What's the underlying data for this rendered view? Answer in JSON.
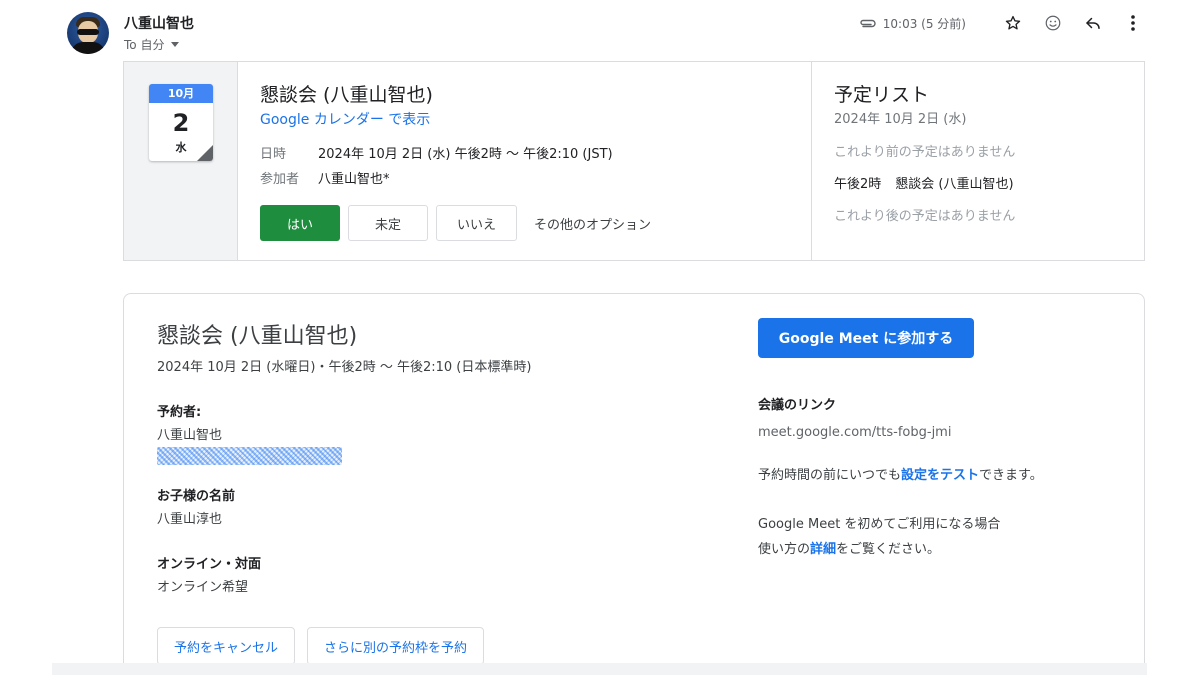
{
  "header": {
    "sender": "八重山智也",
    "to_label": "To 自分",
    "time": "10:03 (5 分前)"
  },
  "invite": {
    "calendar_icon": {
      "month": "10月",
      "day": "2",
      "weekday": "水"
    },
    "title": "懇談会 (八重山智也)",
    "view_link": "Google カレンダー で表示",
    "when_label": "日時",
    "when_value": "2024年 10月 2日 (水) 午後2時 ～ 午後2:10 (JST)",
    "guests_label": "参加者",
    "guests_value": "八重山智也*",
    "rsvp": {
      "yes": "はい",
      "maybe": "未定",
      "no": "いいえ",
      "other": "その他のオプション"
    },
    "agenda": {
      "title": "予定リスト",
      "date": "2024年 10月 2日 (水)",
      "before": "これより前の予定はありません",
      "event_time": "午後2時",
      "event_title": "懇談会 (八重山智也)",
      "after": "これより後の予定はありません"
    }
  },
  "booking": {
    "title": "懇談会 (八重山智也)",
    "subtitle": "2024年 10月 2日 (水曜日)・午後2時 ～ 午後2:10 (日本標準時)",
    "organizer_label": "予約者:",
    "organizer_name": "八重山智也",
    "child_label": "お子様の名前",
    "child_name": "八重山淳也",
    "mode_label": "オンライン・対面",
    "mode_value": "オンライン希望",
    "cancel_button": "予約をキャンセル",
    "book_another_button": "さらに別の予約枠を予約",
    "meet_button": "Google Meet に参加する",
    "meeting_link_label": "会議のリンク",
    "meeting_link": "meet.google.com/tts-fobg-jmi",
    "pre_test_before": "予約時間の前にいつでも",
    "pre_test_link": "設定をテスト",
    "pre_test_after": "できます。",
    "first_time": "Google Meet を初めてご利用になる場合",
    "howto_before": "使い方の",
    "howto_link": "詳細",
    "howto_after": "をご覧ください。"
  },
  "colors": {
    "accent": "#1a73e8",
    "yes_button": "#1e8e3e",
    "calendar_header": "#4285f4"
  },
  "icons": [
    "paperclip-icon",
    "star-icon",
    "emoji-icon",
    "reply-icon",
    "more-vert-icon",
    "caret-down-icon"
  ]
}
